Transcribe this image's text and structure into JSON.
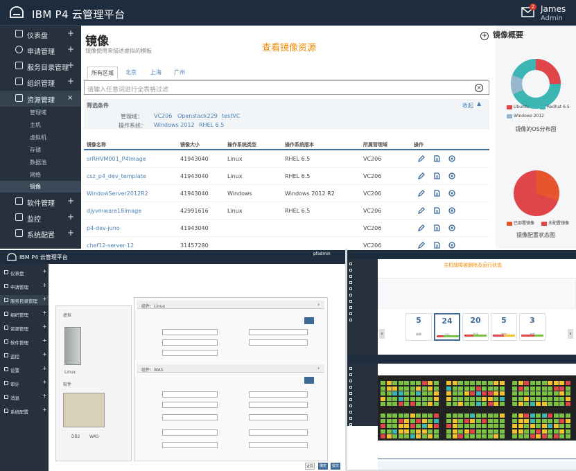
{
  "app": {
    "title": "IBM P4 云管理平台",
    "user_name": "James",
    "user_role": "Admin",
    "mail_count": "2"
  },
  "sidebar": {
    "items": [
      {
        "label": "仪表盘",
        "icon": "dashboard-icon"
      },
      {
        "label": "申请管理",
        "icon": "gear-icon"
      },
      {
        "label": "服务目录管理",
        "icon": "network-icon"
      },
      {
        "label": "组织管理",
        "icon": "org-icon"
      },
      {
        "label": "资源管理",
        "icon": "resource-icon",
        "expanded": true
      },
      {
        "label": "软件管理",
        "icon": "software-icon"
      },
      {
        "label": "监控",
        "icon": "monitor-icon"
      },
      {
        "label": "系统配置",
        "icon": "settings-icon"
      }
    ],
    "subitems": [
      "管理域",
      "主机",
      "虚拟机",
      "存储",
      "数据池",
      "网络",
      "镜像"
    ],
    "selected_sub": "镜像"
  },
  "page": {
    "title": "镜像",
    "subtitle": "镜像使用来描述虚拟的模板",
    "hint": "查看镜像资源",
    "tabs": [
      "所有区域",
      "北京",
      "上海",
      "广州"
    ],
    "search_placeholder": "请输入任意词进行全表格过滤",
    "filter": {
      "label": "筛选条件",
      "collapse": "收起",
      "domain_label": "管理域：",
      "domains": [
        "VC206",
        "Openstack229",
        "testVC"
      ],
      "os_label": "操作系统：",
      "os": [
        "Windows 2012",
        "RHEL 6.5"
      ]
    },
    "columns": [
      "镜像名称",
      "镜像大小",
      "操作系统类型",
      "操作系统版本",
      "所属管理域",
      "操作"
    ],
    "rows": [
      {
        "name": "srRHVM001_P4Image",
        "size": "41943040",
        "os_type": "Linux",
        "os_ver": "RHEL 6.5",
        "domain": "VC206"
      },
      {
        "name": "csz_p4_dev_template",
        "size": "41943040",
        "os_type": "Linux",
        "os_ver": "RHEL 6.5",
        "domain": "VC206"
      },
      {
        "name": "WindowServer2012R2",
        "size": "41943040",
        "os_type": "Windows",
        "os_ver": "Windows 2012 R2",
        "domain": "VC206"
      },
      {
        "name": "djyvmware18image",
        "size": "42991616",
        "os_type": "Linux",
        "os_ver": "RHEL 6.5",
        "domain": "VC206"
      },
      {
        "name": "p4-dev-juno",
        "size": "41943040",
        "os_type": "",
        "os_ver": "",
        "domain": "VC206"
      },
      {
        "name": "chef12-server-12",
        "size": "31457280",
        "os_type": "",
        "os_ver": "",
        "domain": "VC206"
      }
    ]
  },
  "overview": {
    "title": "镜像概要",
    "os_chart": {
      "caption": "镜像的OS分布图",
      "legend": [
        "Ubuntu",
        "Redhat 6.5",
        "Windows 2012"
      ],
      "colors": [
        "#e0454a",
        "#3bb6b3",
        "#96b7cc"
      ]
    },
    "state_chart": {
      "caption": "镜像配置状态图",
      "legend": [
        "已部署镜像",
        "未配置镜像"
      ],
      "colors": [
        "#e5562f",
        "#e0454a"
      ]
    }
  },
  "lower_left": {
    "title": "IBM P4 云管理平台",
    "user": "pfadmin",
    "side": [
      "仪表盘",
      "申请管理",
      "服务目录管理",
      "组织管理",
      "资源管理",
      "软件管理",
      "监控",
      "设置",
      "审计",
      "消息",
      "系统配置"
    ],
    "panel_left": "虚拟",
    "panel_left2": "软件",
    "vm_label": "Linux",
    "sw_labels": [
      "DB2",
      "WAS"
    ],
    "section1": "组件：Linux",
    "section2": "组件：WAS",
    "buttons": [
      "返回",
      "确定",
      "提交"
    ]
  },
  "lower_right": {
    "top_hint": "主机故障被删除及运行状态",
    "cards": [
      {
        "value": "5",
        "label": "故障"
      },
      {
        "value": "24",
        "label": "运行"
      },
      {
        "value": "20",
        "label": "关闭"
      },
      {
        "value": "5",
        "label": "维护"
      },
      {
        "value": "3",
        "label": "未知"
      }
    ]
  }
}
